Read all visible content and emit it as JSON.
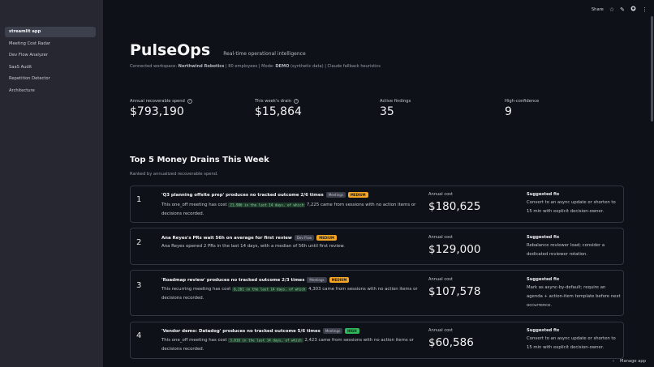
{
  "sidebar": {
    "items": [
      {
        "label": "streamlit app"
      },
      {
        "label": "Meeting Cost Radar"
      },
      {
        "label": "Dev Flow Analyzer"
      },
      {
        "label": "SaaS Audit"
      },
      {
        "label": "Repetition Detector"
      },
      {
        "label": "Architecture"
      }
    ]
  },
  "topbar": {
    "share_label": "Share"
  },
  "header": {
    "title": "PulseOps",
    "tagline": "Real-time operational intelligence",
    "caption_prefix": "Connected workspace: ",
    "workspace": "Northwind Robotics",
    "caption_mid": " | 80 employees | Mode: ",
    "mode": "DEMO",
    "caption_suffix": " (synthetic data) | Claude fallback heuristics"
  },
  "metrics": [
    {
      "label": "Annual recoverable spend",
      "value": "$793,190"
    },
    {
      "label": "This week's drain",
      "value": "$15,864"
    },
    {
      "label": "Active findings",
      "value": "35"
    },
    {
      "label": "High-confidence",
      "value": "9"
    }
  ],
  "section": {
    "title": "Top 5 Money Drains This Week",
    "subtitle": "Ranked by annualized recoverable spend."
  },
  "cost_label": "Annual cost",
  "fix_label": "Suggested fix",
  "findings": [
    {
      "rank": "1",
      "title": "'Q3 planning offsite prep' produces no tracked outcome 2/6 times",
      "tag": "Meetings",
      "severity": "MEDIUM",
      "desc_a": "This one_off meeting has cost ",
      "desc_code": "21,906 in the last 14 days, of which",
      "desc_b": " 7,225 came from sessions with no action items or decisions recorded.",
      "cost": "$180,625",
      "fix": "Convert to an async update or shorten to 15 min with explicit decision-owner."
    },
    {
      "rank": "2",
      "title": "Ana Reyes's PRs wait 56h on average for first review",
      "tag": "Dev Flow",
      "severity": "MEDIUM",
      "desc_a": "Ana Reyes opened 2 PRs in the last 14 days, with a median of 56h until first review.",
      "desc_code": "",
      "desc_b": "",
      "cost": "$129,000",
      "fix": "Rebalance reviewer load; consider a dedicated reviewer rotation."
    },
    {
      "rank": "3",
      "title": "'Roadmap review' produces no tracked outcome 2/3 times",
      "tag": "Meetings",
      "severity": "MEDIUM",
      "desc_a": "This recurring meeting has cost ",
      "desc_code": "6,261 in the last 14 days, of which",
      "desc_b": " 4,303 came from sessions with no action items or decisions recorded.",
      "cost": "$107,578",
      "fix": "Mark as async-by-default; require an agenda + action-item template before next occurrence."
    },
    {
      "rank": "4",
      "title": "'Vendor demo: Datadog' produces no tracked outcome 5/6 times",
      "tag": "Meetings",
      "severity": "HIGH",
      "desc_a": "This one_off meeting has cost ",
      "desc_code": "3,016 in the last 14 days, of which",
      "desc_b": " 2,423 came from sessions with no action items or decisions recorded.",
      "cost": "$60,586",
      "fix": "Convert to an async update or shorten to 15 min with explicit decision-owner."
    }
  ],
  "manage_label": "Manage app"
}
